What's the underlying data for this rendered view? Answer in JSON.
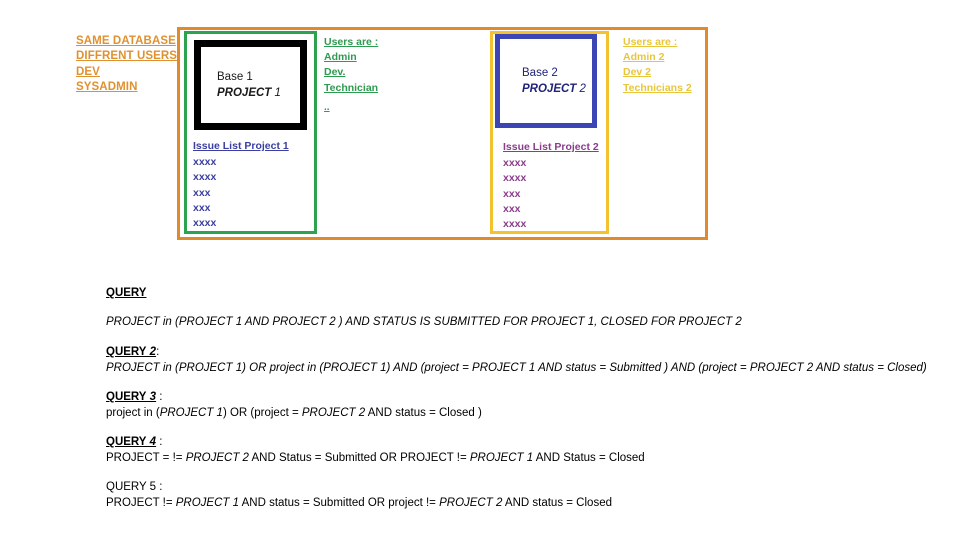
{
  "left_labels": {
    "items": [
      "SAME DATABASE",
      "DIFFRENT USERS",
      "DEV",
      "SYSADMIN"
    ]
  },
  "colors": {
    "orange": "#E08A2E",
    "green": "#2EA34F",
    "yellow": "#F2C230",
    "blue_box": "#3B46B4",
    "issue1_text": "#3B3FA0",
    "issue2_text": "#8C3C8C",
    "users_green_text": "#2E9B50",
    "users_yellow_text": "#E8C63C",
    "left_label_text": "#E0912F",
    "base1_border": "#000000",
    "base2_text": "#20237A"
  },
  "project1": {
    "base": {
      "line1": "Base 1",
      "line2_bold": "PROJECT",
      "line2_suffix": " 1"
    },
    "issue_list": {
      "title": "Issue List Project 1",
      "items": [
        "xxxx",
        "xxxx",
        "xxx",
        "xxx",
        "xxxx"
      ]
    },
    "users": {
      "heading": "Users are :",
      "items": [
        "Admin",
        "Dev.",
        "Technician"
      ],
      "tiny_mark": ".."
    }
  },
  "project2": {
    "base": {
      "line1": "Base 2",
      "line2_bold": "PROJECT",
      "line2_suffix": " 2"
    },
    "issue_list": {
      "title": "Issue List Project 2",
      "items": [
        "xxxx",
        "xxxx",
        "xxx",
        "xxx",
        "xxxx"
      ]
    },
    "users": {
      "heading": "Users are :",
      "items": [
        "Admin 2",
        "Dev 2",
        "Technicians 2"
      ]
    }
  },
  "queries": {
    "q1": {
      "keyword": "QUERY",
      "number": "",
      "tail": "",
      "body": "PROJECT in (PROJECT 1     AND     PROJECT 2 ) AND STATUS IS SUBMITTED FOR PROJECT 1, CLOSED FOR PROJECT 2"
    },
    "q2": {
      "keyword": "QUERY",
      "number": " 2",
      "tail": ":",
      "body": "PROJECT in (PROJECT 1) OR  project in (PROJECT 1) AND (project = PROJECT 1 AND  status = Submitted ) AND (project = PROJECT 2 AND status = Closed)"
    },
    "q3": {
      "keyword": "QUERY",
      "number": " 3",
      "tail": " :",
      "body": "project in (PROJECT 1) OR (project = PROJECT 2 AND  status = Closed )"
    },
    "q4": {
      "keyword": "QUERY",
      "number": " 4",
      "tail": " :",
      "body": "PROJECT = != PROJECT 2 AND Status = Submitted OR PROJECT != PROJECT 1 AND Status = Closed"
    },
    "q5": {
      "keyword": "QUERY",
      "number": " 5",
      "tail": " :",
      "body": "PROJECT != PROJECT 1 AND status = Submitted OR project != PROJECT 2 AND status = Closed"
    }
  }
}
